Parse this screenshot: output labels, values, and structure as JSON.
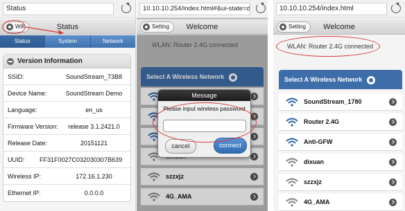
{
  "colors": {
    "accent": "#3d6ea9",
    "annotation": "#d43b3b",
    "tabbar": "#4a7dbb"
  },
  "panel1": {
    "url": "Status",
    "header": {
      "button_label": "Wifi",
      "title": "Status"
    },
    "tabs": [
      {
        "label": "Status"
      },
      {
        "label": "System"
      },
      {
        "label": "Network"
      }
    ],
    "section_title": "Version Information",
    "rows": [
      {
        "label": "SSID:",
        "value": "SoundStream_73B8"
      },
      {
        "label": "Device Name:",
        "value": "SoundStream Demo"
      },
      {
        "label": "Language:",
        "value": "en_us"
      },
      {
        "label": "Firmware Version:",
        "value": "release 3.1.2421.0"
      },
      {
        "label": "Release Date:",
        "value": "20151121"
      },
      {
        "label": "UUID:",
        "value": "FF31F0027C032030307B639"
      },
      {
        "label": "Wireless IP:",
        "value": "172.16.1.230"
      },
      {
        "label": "Ethernet IP:",
        "value": "0.0.0.0"
      }
    ]
  },
  "panel2": {
    "url": "10.10.10.254/index.html#&ui-state=di..",
    "header": {
      "button_label": "Setting",
      "title": "Welcome"
    },
    "status": "WLAN: Router 2.4G connected",
    "list_title": "Select A Wireless Network",
    "networks": [
      {
        "name": ""
      },
      {
        "name": ""
      },
      {
        "name": ""
      },
      {
        "name": "dixuan"
      },
      {
        "name": "szzxjz"
      },
      {
        "name": "4G_AMA"
      }
    ],
    "dialog": {
      "title": "Message",
      "prompt": "Please input wireless password",
      "input_value": "",
      "cancel_label": "cancel",
      "connect_label": "connect"
    }
  },
  "panel3": {
    "url": "10.10.10.254/index.html",
    "header": {
      "button_label": "Setting",
      "title": "Welcome"
    },
    "status": "WLAN: Router 2.4G connected",
    "list_title": "Select A Wireless Network",
    "networks": [
      {
        "name": "SoundStream_1780"
      },
      {
        "name": "Router 2.4G"
      },
      {
        "name": "Anti-GFW"
      },
      {
        "name": "dixuan"
      },
      {
        "name": "szzxjz"
      },
      {
        "name": "4G_AMA"
      }
    ]
  }
}
